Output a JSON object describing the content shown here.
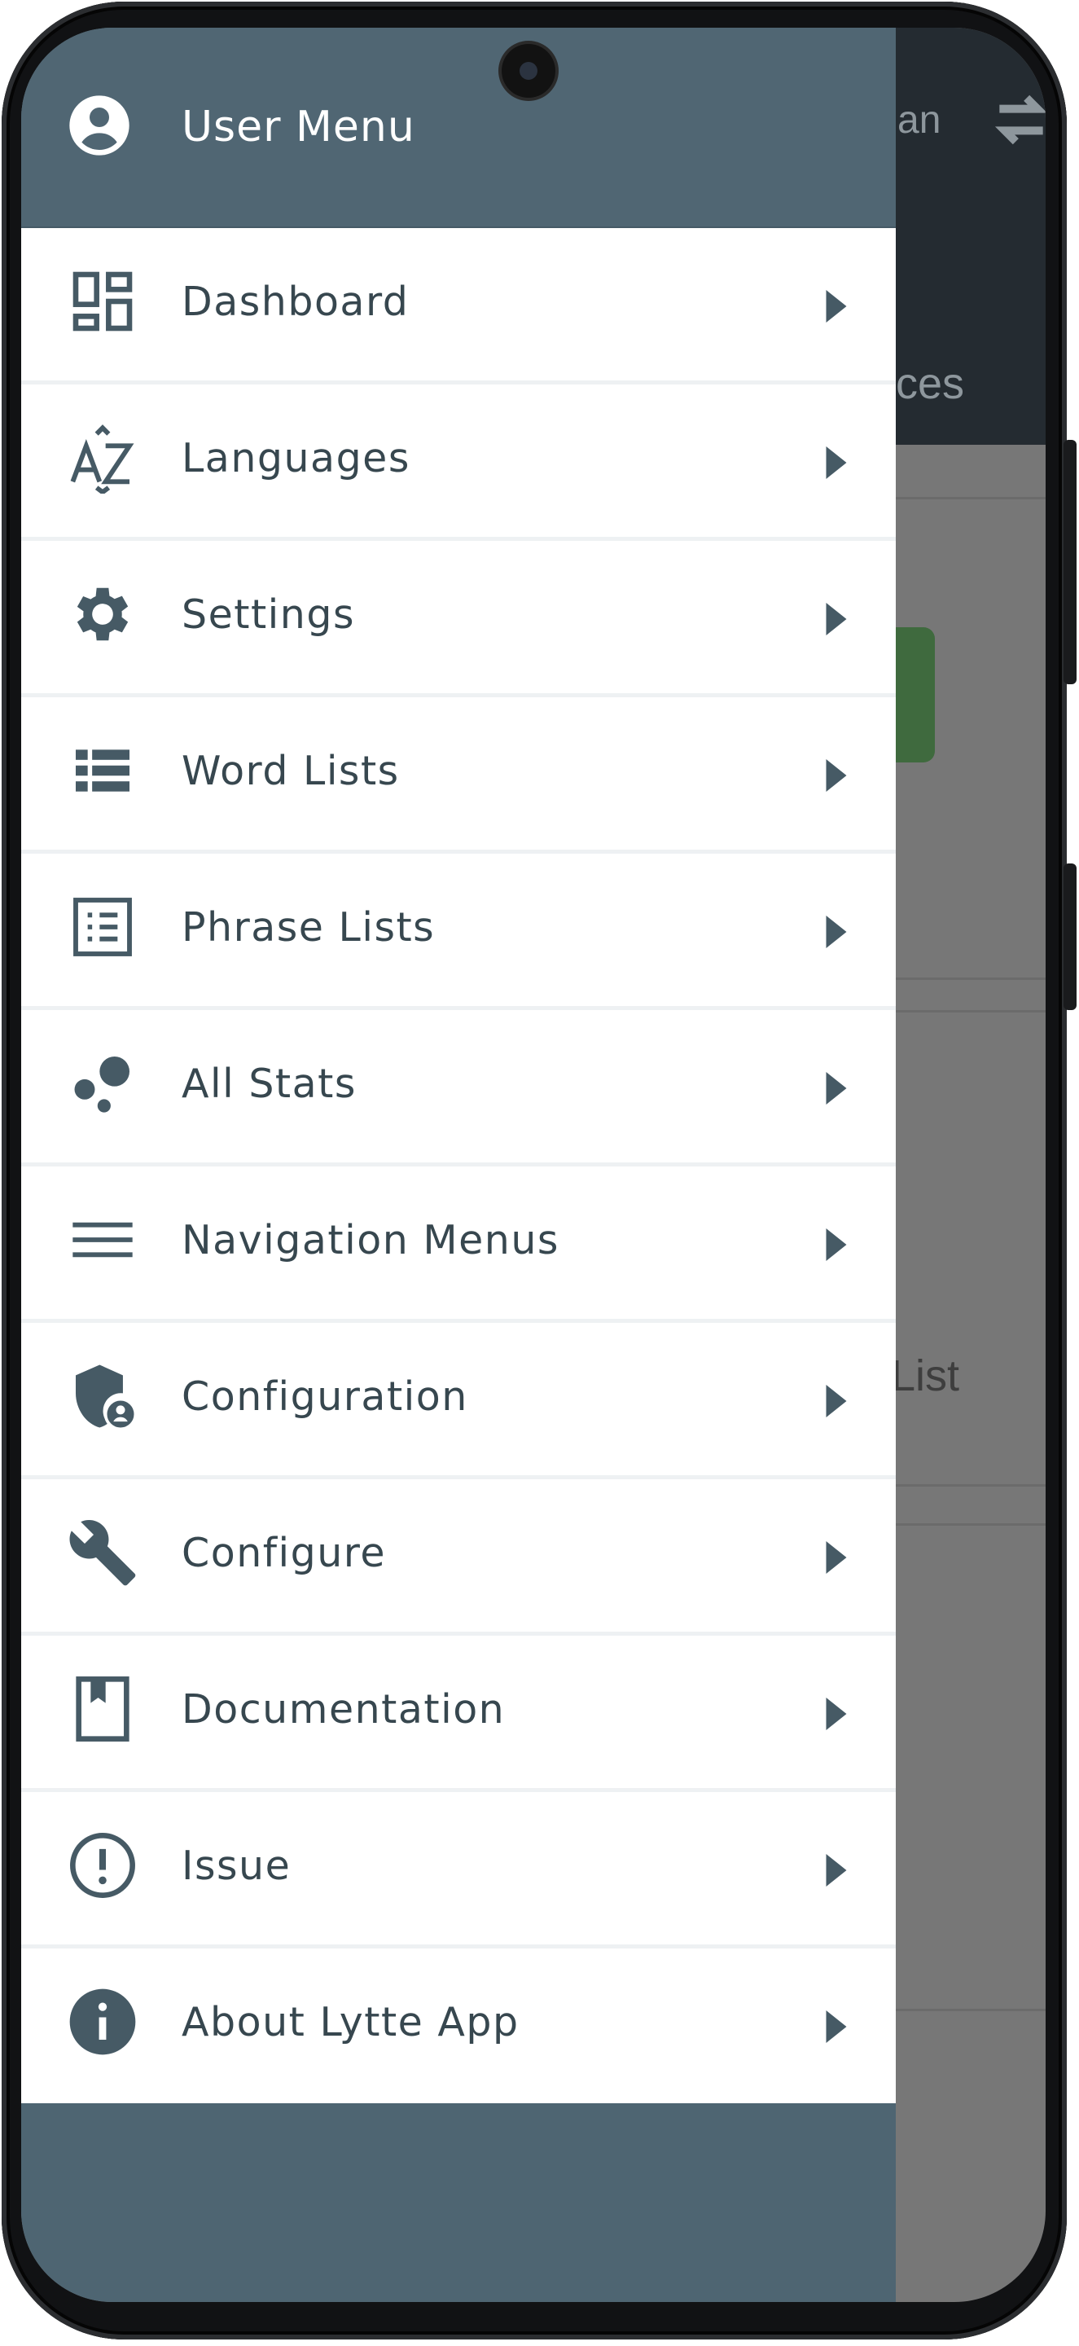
{
  "drawer": {
    "title": "User Menu",
    "items": [
      {
        "label": "Dashboard",
        "icon": "dashboard-icon"
      },
      {
        "label": "Languages",
        "icon": "translate-az-icon"
      },
      {
        "label": "Settings",
        "icon": "gear-icon"
      },
      {
        "label": "Word Lists",
        "icon": "list-icon"
      },
      {
        "label": "Phrase Lists",
        "icon": "list-box-icon"
      },
      {
        "label": "All Stats",
        "icon": "bubble-chart-icon"
      },
      {
        "label": "Navigation Menus",
        "icon": "hamburger-menu-icon"
      },
      {
        "label": "Configuration",
        "icon": "shield-account-icon"
      },
      {
        "label": "Configure",
        "icon": "wrench-icon"
      },
      {
        "label": "Documentation",
        "icon": "book-icon"
      },
      {
        "label": "Issue",
        "icon": "alert-circle-icon"
      },
      {
        "label": "About Lytte App",
        "icon": "info-icon"
      }
    ]
  },
  "background": {
    "top_text_1": "an",
    "top_text_2": "ces",
    "list_text": "List"
  },
  "colors": {
    "header": "#506673",
    "menu_text": "#37474f",
    "icon": "#465a65",
    "background_bar": "#242b31"
  }
}
